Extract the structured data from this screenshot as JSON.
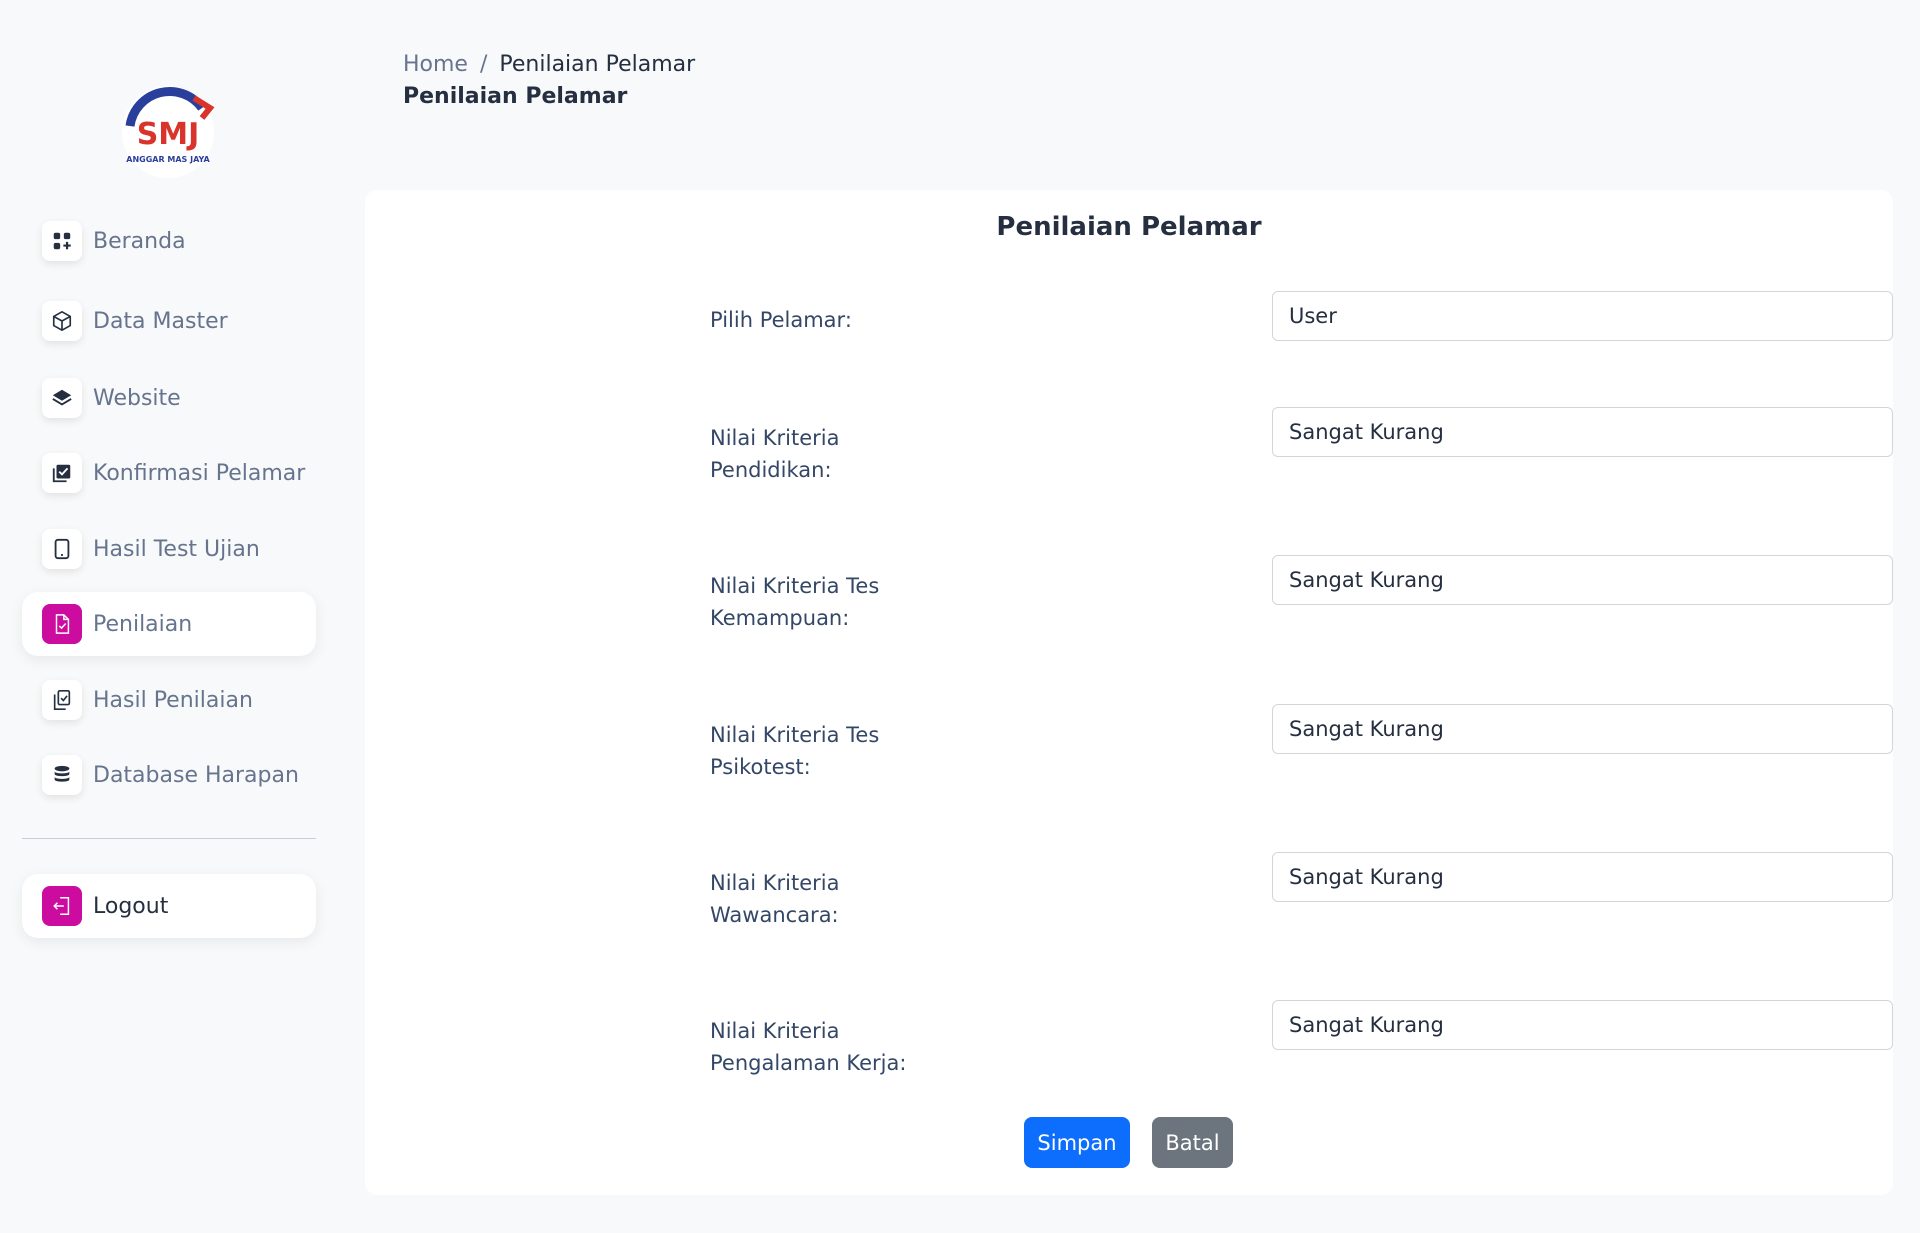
{
  "logo": {
    "text": "SMJ",
    "subtext": "ANGGAR MAS JAYA"
  },
  "sidebar": {
    "items": [
      {
        "label": "Beranda",
        "icon": "dashboard-icon"
      },
      {
        "label": "Data Master",
        "icon": "cube-icon"
      },
      {
        "label": "Website",
        "icon": "layers-icon"
      },
      {
        "label": "Konfirmasi Pelamar",
        "icon": "check-square-icon"
      },
      {
        "label": "Hasil Test Ujian",
        "icon": "tablet-icon"
      },
      {
        "label": "Penilaian",
        "icon": "file-check-icon",
        "active": true
      },
      {
        "label": "Hasil Penilaian",
        "icon": "clipboard-check-icon"
      },
      {
        "label": "Database Harapan",
        "icon": "database-icon"
      }
    ],
    "logout_label": "Logout"
  },
  "header": {
    "breadcrumb_home": "Home",
    "breadcrumb_separator": "/",
    "breadcrumb_current": "Penilaian Pelamar",
    "page_title": "Penilaian Pelamar"
  },
  "form": {
    "title": "Penilaian Pelamar",
    "fields": [
      {
        "label": "Pilih Pelamar:",
        "value": "User"
      },
      {
        "label": "Nilai Kriteria Pendidikan:",
        "value": "Sangat Kurang"
      },
      {
        "label": "Nilai Kriteria Tes Kemampuan:",
        "value": "Sangat Kurang"
      },
      {
        "label": "Nilai Kriteria Tes Psikotest:",
        "value": "Sangat Kurang"
      },
      {
        "label": "Nilai Kriteria Wawancara:",
        "value": "Sangat Kurang"
      },
      {
        "label": "Nilai Kriteria Pengalaman Kerja:",
        "value": "Sangat Kurang"
      }
    ],
    "save_label": "Simpan",
    "cancel_label": "Batal"
  },
  "colors": {
    "accent": "#cb0c9f",
    "primary_button": "#0d6efd",
    "secondary_button": "#6c757d"
  }
}
